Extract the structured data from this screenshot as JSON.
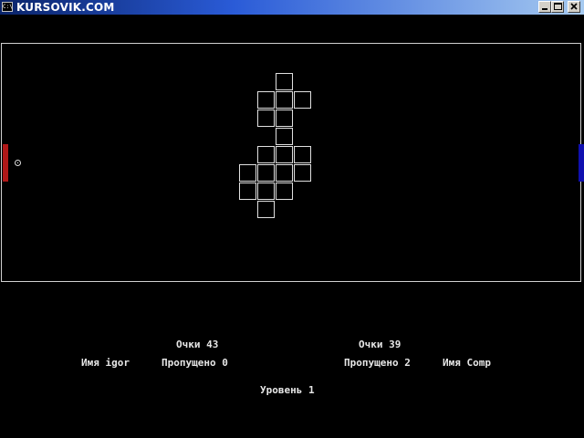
{
  "window": {
    "title": "KURSOVIK.COM",
    "icon_text": "C:\\",
    "buttons": [
      "minimize-icon",
      "maximize-icon",
      "close-icon"
    ]
  },
  "colors": {
    "background": "#000000",
    "left_paddle": "#b01818",
    "right_paddle": "#1010b0",
    "brick_outline": "#e0e0e0",
    "text": "#e6e6e6"
  },
  "player": {
    "score_label": "Очки 43",
    "name_label": "Имя igor",
    "missed_label": "Пропущено 0"
  },
  "computer": {
    "score_label": "Очки 39",
    "missed_label": "Пропущено 2",
    "name_label": "Имя Comp"
  },
  "level_label": "Уровень 1"
}
